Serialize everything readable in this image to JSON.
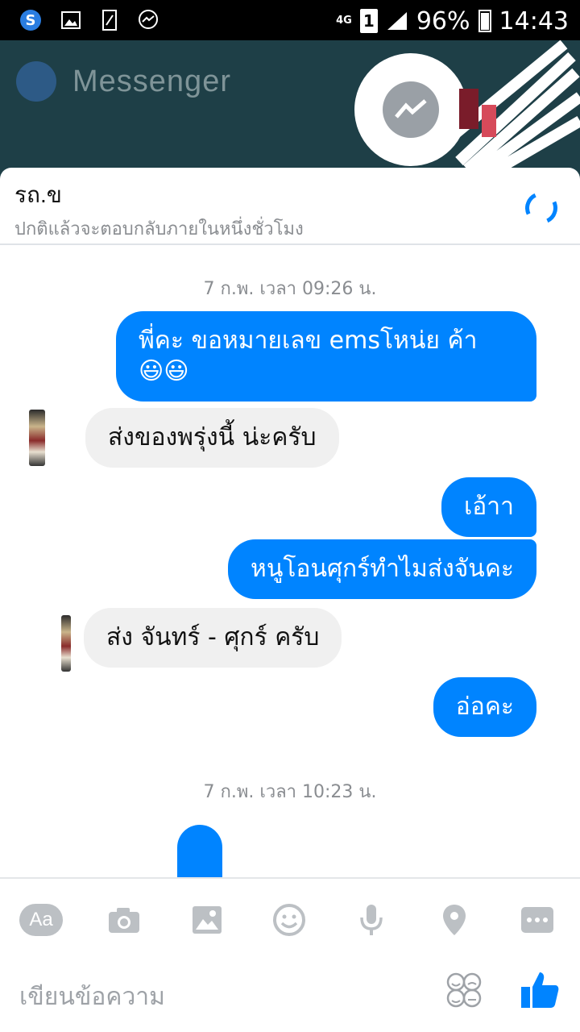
{
  "status_bar": {
    "network": "4G",
    "sim": "1",
    "battery": "96%",
    "time": "14:43"
  },
  "background_app": {
    "title": "Messenger"
  },
  "header": {
    "contact_name": "รถ.ข",
    "contact_status": "ปกติแล้วจะตอบกลับภายในหนึ่งชั่วโมง"
  },
  "messages": [
    {
      "type": "timestamp",
      "text": "7 ก.พ. เวลา 09:26 น."
    },
    {
      "type": "out",
      "text": "พี่คะ ขอหมายเลข emsโหน่ย ค้า\n😃😃"
    },
    {
      "type": "in",
      "text": "ส่งของพรุ่งนี้ น่ะครับ"
    },
    {
      "type": "out",
      "text": "เอ้าา"
    },
    {
      "type": "out",
      "text": "หนูโอนศุกร์ทำไมส่งจันคะ"
    },
    {
      "type": "in",
      "text": "ส่ง จันทร์ - ศุกร์ ครับ"
    },
    {
      "type": "out",
      "text": "อ่อคะ"
    },
    {
      "type": "timestamp",
      "text": "7 ก.พ. เวลา 10:23 น."
    }
  ],
  "composer": {
    "tools": [
      "text-aa-icon",
      "camera-icon",
      "image-icon",
      "emoji-icon",
      "microphone-icon",
      "location-icon",
      "more-icon"
    ],
    "aa_label": "Aa",
    "input_placeholder": "เขียนข้อความ"
  },
  "colors": {
    "accent": "#0084ff",
    "incoming_bubble": "#f0f0f0",
    "icon_gray": "#bcc0c4"
  }
}
